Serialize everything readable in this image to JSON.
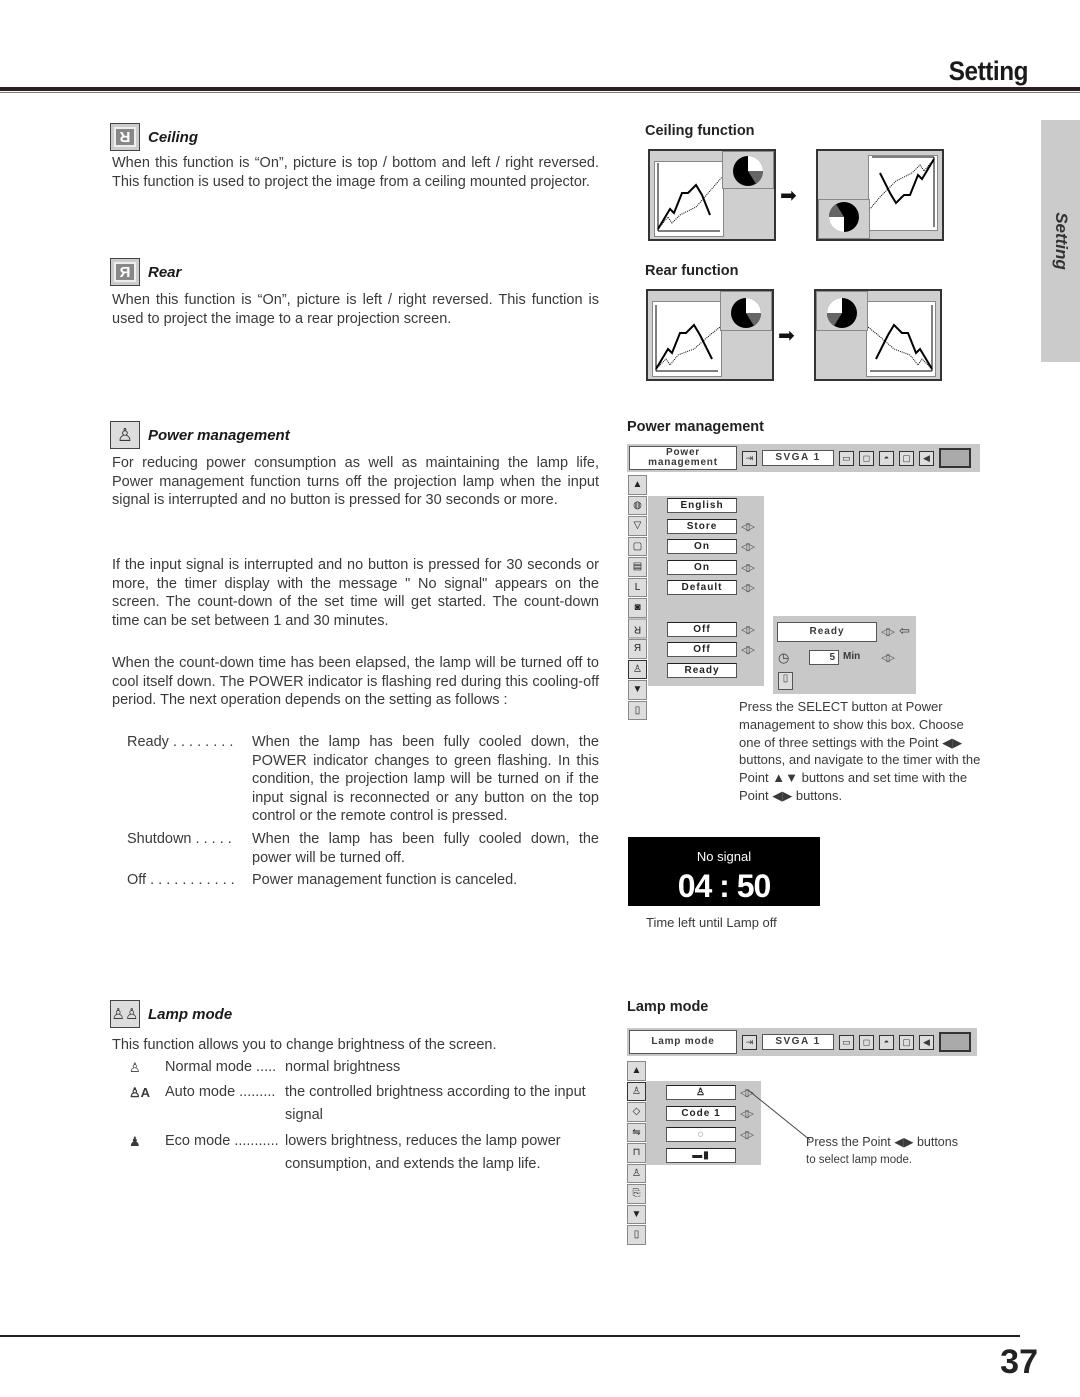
{
  "header": {
    "title": "Setting"
  },
  "side_tab": {
    "label": "Setting"
  },
  "ceiling": {
    "title": "Ceiling",
    "icon": "ceiling-r-icon",
    "icon_glyph": "R",
    "body": "When this function is “On”, picture is top / bottom and left / right reversed.  This function is used to project the image from a ceiling mounted projector.",
    "diagram_heading": "Ceiling function"
  },
  "rear": {
    "title": "Rear",
    "icon": "rear-r-icon",
    "icon_glyph": "Я",
    "body": "When this function is “On”, picture is left / right reversed.  This function is used to project the image to a rear projection screen.",
    "diagram_heading": "Rear function"
  },
  "power": {
    "title": "Power management",
    "icon": "lamp-bulb-icon",
    "p1": "For reducing power consumption as well as maintaining the lamp life, Power management function turns off the projection lamp when the input signal is interrupted and no button is pressed for 30 seconds or more.",
    "p2": "If the input signal is interrupted and no button is pressed for 30 seconds or more, the timer display with the message \" No signal\" appears on the screen.  The count-down of the set time will get started.  The count-down time can be set between 1 and 30 minutes.",
    "p3": "When the count-down time has been elapsed, the lamp will be turned off to cool itself down.  The POWER indicator is flashing red during this cooling-off period.  The next operation depends on the setting as follows :",
    "options": [
      {
        "term": "Ready . . . . . . . .",
        "desc": "When the lamp has been fully cooled down, the POWER indicator changes to green flashing.  In this condition, the projection lamp will be turned on if the input signal is reconnected or any button on the top control or the remote control is pressed."
      },
      {
        "term": "Shutdown . . . . .",
        "desc": "When the lamp has been fully cooled down, the power will be turned off."
      },
      {
        "term": "Off . . . . . . . . . . .",
        "desc": "Power management function is canceled."
      }
    ],
    "diagram_heading": "Power management",
    "osd": {
      "title_line1": "Power",
      "title_line2": "management",
      "source": "SVGA 1",
      "rows": [
        {
          "icon": "globe-icon",
          "value": "English",
          "arrows": false
        },
        {
          "icon": "keystone-icon",
          "value": "Store",
          "arrows": true
        },
        {
          "icon": "blue-back-icon",
          "value": "On",
          "arrows": true
        },
        {
          "icon": "display-icon",
          "value": "On",
          "arrows": true
        },
        {
          "icon": "logo-icon",
          "value": "Default",
          "arrows": true
        },
        {
          "icon": "capture-icon",
          "value": "",
          "arrows": false
        },
        {
          "icon": "ceiling-icon",
          "value": "Off",
          "arrows": true
        },
        {
          "icon": "rear-icon",
          "value": "Off",
          "arrows": true
        },
        {
          "icon": "power-mgmt-icon",
          "value": "Ready",
          "arrows": false
        }
      ],
      "sub": {
        "mode": "Ready",
        "timer_value": "5",
        "timer_unit": "Min"
      }
    },
    "caption": "Press the SELECT button at Power management to show this box. Choose one of three settings with the Point ◀▶ buttons, and navigate to the timer with the Point ▲▼ buttons and set time with the Point ◀▶ buttons.",
    "nosignal": {
      "message": "No signal",
      "time": "04 : 50",
      "caption": "Time left until Lamp off"
    }
  },
  "lamp": {
    "title": "Lamp mode",
    "icon": "lamp-mode-icon",
    "intro": "This function allows you to change brightness of the screen.",
    "modes": [
      {
        "icon": "normal-lamp-icon",
        "glyph": "♙",
        "term": "Normal mode .....",
        "desc": "normal brightness"
      },
      {
        "icon": "auto-lamp-icon",
        "glyph": "♙A",
        "term": "Auto mode .........",
        "desc": "the controlled brightness according to the input signal"
      },
      {
        "icon": "eco-lamp-icon",
        "glyph": "♟",
        "term": "Eco mode ...........",
        "desc": "lowers brightness, reduces the lamp power consumption, and extends the lamp life."
      }
    ],
    "diagram_heading": "Lamp mode",
    "osd": {
      "title": "Lamp mode",
      "source": "SVGA 1",
      "rows": [
        {
          "icon": "lamp-mode-icon",
          "value": "♙",
          "arrows": true
        },
        {
          "icon": "remote-code-icon",
          "value": "Code 1",
          "arrows": true
        },
        {
          "icon": "usb-icon",
          "value": "◌",
          "arrows": true
        },
        {
          "icon": "lock-icon",
          "value": "▬▮",
          "arrows": false
        }
      ]
    },
    "caption_line1": "Press the Point ◀▶ buttons",
    "caption_line2": "to select lamp mode."
  },
  "page_number": "37"
}
